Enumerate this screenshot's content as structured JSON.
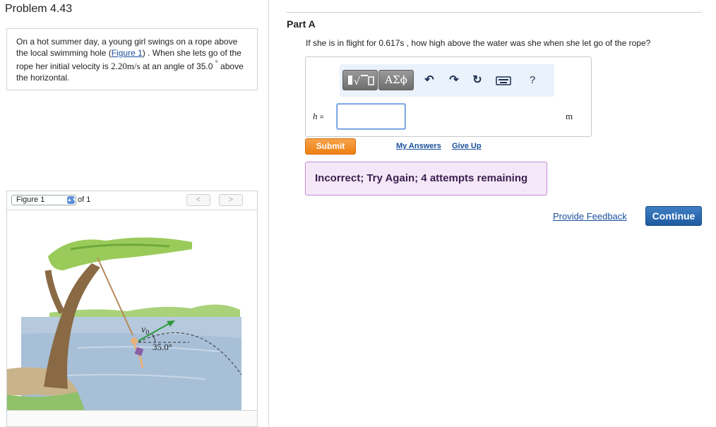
{
  "problem": {
    "title": "Problem 4.43",
    "text_before_link": "On a hot summer day, a young girl swings on a rope above the local swimming hole (",
    "link_text": "Figure 1",
    "text_after_link": ") . When she lets go of the rope her initial velocity is ",
    "velocity": "2.20m/s",
    "text_after_velocity": " at an angle of ",
    "angle": "35.0",
    "degree_sign": "°",
    "text_end": " above the horizontal."
  },
  "figure": {
    "select_label": "Figure 1",
    "of_label": "of 1",
    "prev_label": "<",
    "next_label": ">",
    "velocity_symbol": "v",
    "velocity_subscript": "0",
    "angle_label": "35.0°"
  },
  "part": {
    "title": "Part A",
    "question": "If she is in flight for 0.617s , how high above the water was she when she let go of the rope?"
  },
  "toolbar": {
    "greek_label": "ΑΣϕ",
    "help_label": "?",
    "icons": [
      "templates-icon",
      "greek-symbols-icon",
      "undo-icon",
      "redo-icon",
      "reset-icon",
      "keyboard-icon",
      "help-icon"
    ]
  },
  "answer": {
    "variable": "h",
    "equals": "=",
    "value": "",
    "unit": "m"
  },
  "actions": {
    "submit_label": "Submit",
    "my_answers_label": "My Answers",
    "give_up_label": "Give Up"
  },
  "feedback": {
    "message": "Incorrect; Try Again; 4 attempts remaining"
  },
  "footer": {
    "provide_feedback_label": "Provide Feedback",
    "continue_label": "Continue"
  },
  "colors": {
    "link": "#1a4f9c",
    "submit": "#ee7f10",
    "continue": "#1e5aa0",
    "feedback_bg": "#f4e8f8",
    "feedback_border": "#c58ad9"
  }
}
